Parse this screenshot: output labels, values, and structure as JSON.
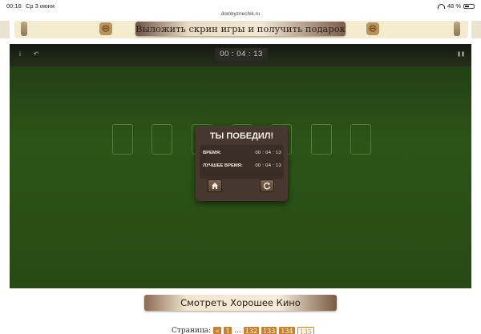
{
  "status_bar": {
    "time": "00:16",
    "date": "Ср 3 июня",
    "battery": "48 %",
    "battery_fraction": 0.48
  },
  "browser": {
    "url": "domkyznechik.ru"
  },
  "banner": {
    "cta_label": "Выложить скрин игры и получить подарок",
    "emoji_left": "😄",
    "emoji_right": "😄"
  },
  "game": {
    "timer": "00 : 04 : 13",
    "info_icon": "i",
    "undo_icon": "↶",
    "pause_icon": "❚❚",
    "slot_count": 7
  },
  "win_dialog": {
    "title": "ТЫ ПОБЕДИЛ!",
    "time_label": "ВРЕМЯ:",
    "time_value": "00 : 04 : 13",
    "best_label": "ЛУЧШЕЕ ВРЕМЯ:",
    "best_value": "00 : 04 : 13",
    "home_icon": "home-icon",
    "restart_icon": "restart-icon"
  },
  "movie_button": {
    "label": "Смотреть Хорошее Кино"
  },
  "pagination": {
    "label": "Страница:",
    "items": [
      "«",
      "1",
      "...",
      "132",
      "133",
      "134",
      "135"
    ],
    "current": "135"
  },
  "colors": {
    "felt": "#2c5418",
    "dialog": "#47382f",
    "accent": "#c7822f"
  }
}
